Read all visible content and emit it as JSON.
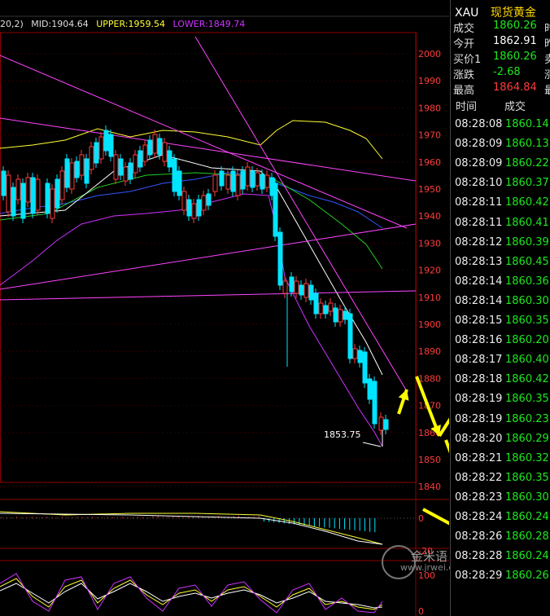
{
  "indicator_header": {
    "params": "20,2)",
    "mid": "MID:1904.64",
    "upper": "UPPER:1959.54",
    "lower": "LOWER:1849.74"
  },
  "y_axis_labels": [
    "2000",
    "1990",
    "1980",
    "1970",
    "1960",
    "1950",
    "1940",
    "1930",
    "1920",
    "1910",
    "1900",
    "1890",
    "1880",
    "1870",
    "1860",
    "1850",
    "1840"
  ],
  "macd_axis_labels": [
    "0",
    "-20"
  ],
  "kdj_axis_labels": [
    "100",
    "0"
  ],
  "low_annotation": "1853.75",
  "watermark": {
    "logo": "金米语",
    "url": "www.jrwei.com"
  },
  "panel": {
    "symbol": "XAU",
    "name": "现货黄金",
    "quotes": [
      {
        "label": "成交",
        "value": "1860.26",
        "color": "#1ee81e",
        "extra": "时"
      },
      {
        "label": "今开",
        "value": "1862.91",
        "color": "#ffffff",
        "extra": "昨"
      },
      {
        "label": "买价1",
        "value": "1860.26",
        "color": "#1ee81e",
        "extra": "卖"
      },
      {
        "label": "涨跌",
        "value": "-2.68",
        "color": "#1ee81e",
        "extra": "涨"
      },
      {
        "label": "最高",
        "value": "1864.84",
        "color": "#ff3b3b",
        "extra": "最"
      }
    ],
    "tick_headers": {
      "time": "时间",
      "price": "成交"
    },
    "ticks": [
      {
        "time": "08:28:08",
        "price": "1860.14"
      },
      {
        "time": "08:28:09",
        "price": "1860.13"
      },
      {
        "time": "08:28:09",
        "price": "1860.22"
      },
      {
        "time": "08:28:10",
        "price": "1860.37"
      },
      {
        "time": "08:28:11",
        "price": "1860.42"
      },
      {
        "time": "08:28:11",
        "price": "1860.41"
      },
      {
        "time": "08:28:12",
        "price": "1860.39"
      },
      {
        "time": "08:28:13",
        "price": "1860.45"
      },
      {
        "time": "08:28:14",
        "price": "1860.36"
      },
      {
        "time": "08:28:14",
        "price": "1860.30"
      },
      {
        "time": "08:28:15",
        "price": "1860.35"
      },
      {
        "time": "08:28:16",
        "price": "1860.20"
      },
      {
        "time": "08:28:17",
        "price": "1860.40"
      },
      {
        "time": "08:28:18",
        "price": "1860.42"
      },
      {
        "time": "08:28:19",
        "price": "1860.35"
      },
      {
        "time": "08:28:19",
        "price": "1860.23"
      },
      {
        "time": "08:28:20",
        "price": "1860.29"
      },
      {
        "time": "08:28:21",
        "price": "1860.32"
      },
      {
        "time": "08:28:22",
        "price": "1860.35"
      },
      {
        "time": "08:28:23",
        "price": "1860.30"
      },
      {
        "time": "08:28:24",
        "price": "1860.24"
      },
      {
        "time": "08:28:26",
        "price": "1860.28"
      },
      {
        "time": "08:28:28",
        "price": "1860.24"
      },
      {
        "time": "08:28:29",
        "price": "1860.26"
      }
    ]
  },
  "colors": {
    "candle_up": "#ff3b3b",
    "candle_down": "#00e5ff",
    "upper_band": "#ffff33",
    "lower_band": "#cc33ff",
    "mid_band": "#3355ff",
    "trendline": "#ff44ff",
    "annotation_arrow": "#ffff00",
    "grid_red": "#8b0000"
  }
}
